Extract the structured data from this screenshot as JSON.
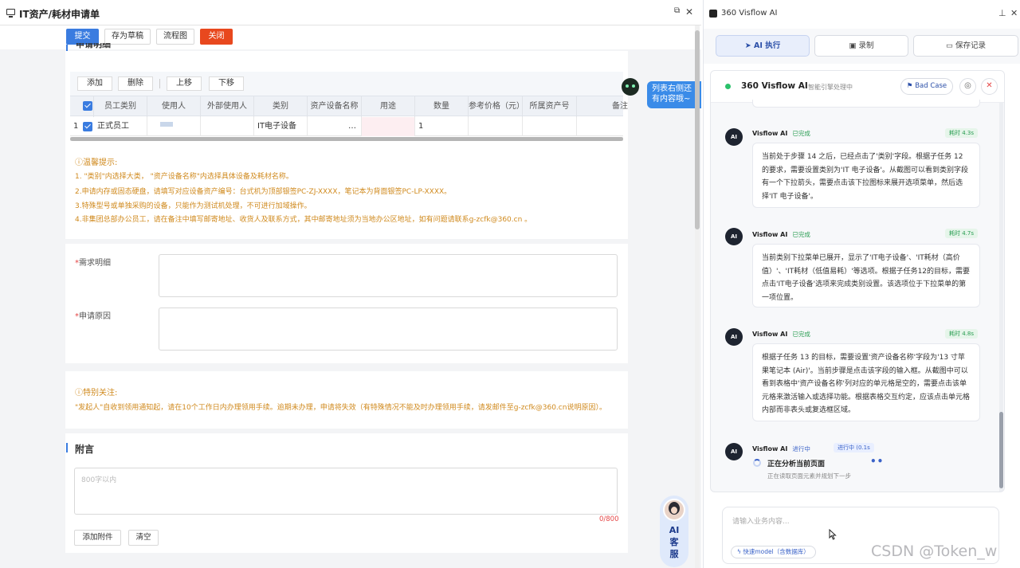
{
  "left_window": {
    "title": "IT资产/耗材申请单",
    "controls": {
      "restore": "⧉",
      "close": "✕"
    },
    "toolbar": {
      "submit": "提交",
      "save_draft": "存为草稿",
      "flowchart": "流程图",
      "close": "关闭"
    },
    "section_cut_title": "申请明细",
    "table_tools": {
      "add": "添加",
      "delete": "删除",
      "move_up": "上移",
      "move_down": "下移"
    },
    "columns": [
      "员工类别",
      "使用人",
      "外部使用人",
      "类别",
      "资产设备名称",
      "用途",
      "数量",
      "参考价格（元）",
      "所属资产号",
      "备注"
    ],
    "rows": [
      {
        "index": "1",
        "employee_type": "正式员工",
        "user": "",
        "external_user": "",
        "category": "IT电子设备",
        "asset_name": "…",
        "purpose": "",
        "quantity": "1",
        "ref_price": "",
        "asset_no": "",
        "remark": ""
      }
    ],
    "tips": {
      "title": "ⓘ温馨提示:",
      "lines": [
        "1. \"类别\"内选择大类， \"资产设备名称\"内选择具体设备及耗材名称。",
        "2.申请内存或固态硬盘，请填写对应设备资产编号：台式机为顶部银签PC-ZJ-XXXX，笔记本为背面银签PC-LP-XXXX。",
        "3.特殊型号或单独采购的设备，只能作为测试机处理，不可进行加域操作。",
        "4.非集团总部办公员工，请在备注中填写邮寄地址、收货人及联系方式，其中邮寄地址须为当地办公区地址，如有问题请联系g-zcfk@360.cn 。"
      ]
    },
    "fields": {
      "demand_label": "需求明细",
      "reason_label": "申请原因",
      "required_mark": "*"
    },
    "notice": {
      "title": "ⓘ特别关注:",
      "text": "\"发起人\"自收到领用通知起，请在10个工作日内办理领用手续。逾期未办理，申请将失效（有特殊情况不能及时办理领用手续，请发邮件至g-zcfk@360.cn说明原因）。"
    },
    "attachment": {
      "title": "附言",
      "placeholder": "800字以内",
      "counter": "0/800",
      "add_attachment": "添加附件",
      "clear": "清空"
    },
    "bubble_text": "列表右侧还有内容哦~",
    "ai_service": [
      "AI",
      "客",
      "服"
    ]
  },
  "right_panel": {
    "title": "360 Visflow AI",
    "controls": {
      "pin": "⊥",
      "close": "✕"
    },
    "tabs": [
      {
        "label": "AI 执行",
        "icon": "send-icon",
        "active": true
      },
      {
        "label": "录制",
        "icon": "record-icon",
        "active": false
      },
      {
        "label": "保存记录",
        "icon": "save-icon",
        "active": false
      }
    ],
    "chat_header": {
      "name": "360 Visflow AI",
      "status": "智能引擎处理中",
      "bad_case": "Bad Case",
      "status_color": "#2bc16b"
    },
    "messages": [
      {
        "avatar": "AI",
        "sender": "Visflow AI",
        "status": "已完成",
        "duration": "耗时 4.3s",
        "text": "当前处于步骤 14 之后，已经点击了'类别'字段。根据子任务 12 的要求，需要设置类别为'IT 电子设备'。从截图可以看到类别字段有一个下拉箭头，需要点击该下拉图标来展开选项菜单，然后选择'IT 电子设备'。"
      },
      {
        "avatar": "AI",
        "sender": "Visflow AI",
        "status": "已完成",
        "duration": "耗时 4.7s",
        "text": "当前类别下拉菜单已展开，显示了'IT电子设备'、'IT耗材（高价值）'、'IT耗材（低值易耗）'等选项。根据子任务12的目标，需要点击'IT电子设备'选项来完成类别设置。该选项位于下拉菜单的第一项位置。"
      },
      {
        "avatar": "AI",
        "sender": "Visflow AI",
        "status": "已完成",
        "duration": "耗时 4.8s",
        "text": "根据子任务 13 的目标，需要设置'资产设备名称'字段为'13 寸苹果笔记本 (Air)'。当前步骤是点击该字段的输入框。从截图中可以看到表格中'资产设备名称'列对应的单元格是空的，需要点击该单元格来激活输入或选择功能。根据表格交互约定，应该点击单元格内部而非表头或复选框区域。"
      },
      {
        "avatar": "AI",
        "sender": "Visflow AI",
        "status": "进行中",
        "duration": "进行中 (0.1s",
        "title": "正在分析当前页面",
        "subtitle": "正在读取页面元素并规划下一步",
        "typing": "••"
      }
    ],
    "input": {
      "placeholder": "请输入业务内容...",
      "model": "快速model（含数据库）"
    }
  },
  "watermark": "CSDN @Token_w",
  "colors": {
    "primary": "#3a7ce0",
    "danger": "#e8481e",
    "tip": "#d08a1e",
    "done": "#2a9d53",
    "running": "#3a62c8"
  }
}
